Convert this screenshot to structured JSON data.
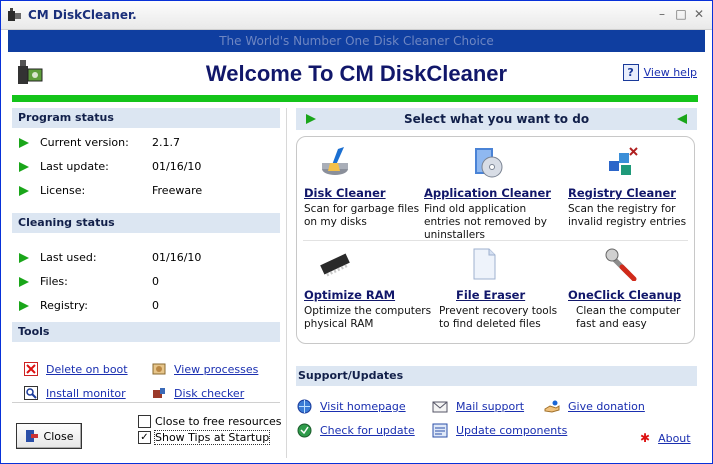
{
  "window": {
    "title": "CM DiskCleaner.",
    "minimize": "–",
    "maximize": "□",
    "close": "✕"
  },
  "banner": "The World's Number One Disk Cleaner Choice",
  "header": {
    "welcome": "Welcome To CM DiskCleaner",
    "help_label": "View help",
    "help_icon": "?"
  },
  "program_status": {
    "heading": "Program status",
    "rows": [
      {
        "label": "Current version:",
        "value": "2.1.7"
      },
      {
        "label": "Last update:",
        "value": "01/16/10"
      },
      {
        "label": "License:",
        "value": "Freeware"
      }
    ]
  },
  "cleaning_status": {
    "heading": "Cleaning status",
    "rows": [
      {
        "label": "Last used:",
        "value": "01/16/10"
      },
      {
        "label": "Files:",
        "value": "0"
      },
      {
        "label": "Registry:",
        "value": "0"
      }
    ]
  },
  "tools": {
    "heading": "Tools",
    "delete_on_boot": "Delete on boot",
    "view_processes": "View processes",
    "install_monitor": "Install monitor",
    "disk_checker": "Disk checker"
  },
  "footer": {
    "close_label": "Close",
    "close_to_free": "Close to free resources",
    "show_tips": "Show Tips at Startup",
    "close_to_free_checked": false,
    "show_tips_checked": true
  },
  "tasks": {
    "heading": "Select what you want to do",
    "items": [
      {
        "title": "Disk Cleaner",
        "desc": "Scan for garbage files on my disks"
      },
      {
        "title": "Application Cleaner",
        "desc": "Find old application entries not removed by uninstallers"
      },
      {
        "title": "Registry Cleaner",
        "desc": "Scan the registry for invalid registry entries"
      },
      {
        "title": "Optimize RAM",
        "desc": "Optimize the computers physical RAM"
      },
      {
        "title": "File Eraser",
        "desc": "Prevent recovery tools to find deleted files"
      },
      {
        "title": "OneClick Cleanup",
        "desc": "Clean the computer fast and easy"
      }
    ]
  },
  "support": {
    "heading": "Support/Updates",
    "visit_homepage": "Visit homepage",
    "mail_support": "Mail support",
    "give_donation": "Give donation",
    "check_update": "Check for update",
    "update_components": "Update components",
    "about": "About"
  },
  "colors": {
    "accent_green": "#14c41a",
    "banner_blue": "#0f3ea0",
    "title_navy": "#11176a",
    "section_bg": "#dce6f2"
  }
}
